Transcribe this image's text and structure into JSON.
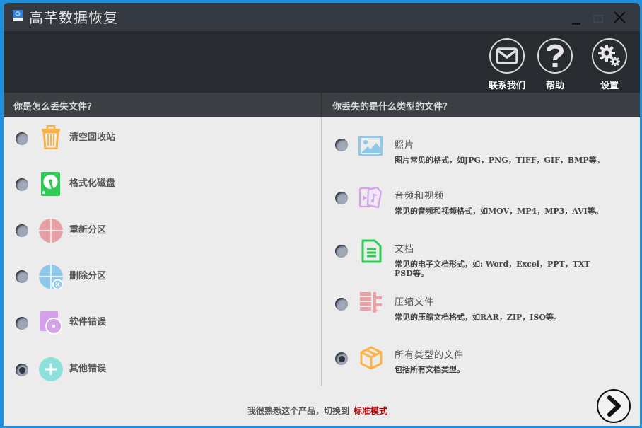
{
  "window": {
    "title": "高芊数据恢复"
  },
  "toolbar": {
    "contact_label": "联系我们",
    "help_label": "帮助",
    "settings_label": "设置"
  },
  "loss_section": {
    "heading": "你是怎么丢失文件？",
    "options": [
      {
        "label": "清空回收站",
        "icon": "trash-icon",
        "color": "#fbb444",
        "selected": false
      },
      {
        "label": "格式化磁盘",
        "icon": "hard-disk-icon",
        "color": "#2ecc55",
        "selected": false
      },
      {
        "label": "重新分区",
        "icon": "partition-icon",
        "color": "#e8a0a4",
        "selected": false
      },
      {
        "label": "删除分区",
        "icon": "delete-partition-icon",
        "color": "#8ec9ec",
        "selected": false
      },
      {
        "label": "软件错误",
        "icon": "software-error-icon",
        "color": "#d4a2e6",
        "selected": false
      },
      {
        "label": "其他错误",
        "icon": "plus-icon",
        "color": "#8ee0dc",
        "selected": true
      }
    ]
  },
  "type_section": {
    "heading": "你丢失的是什么类型的文件？",
    "options": [
      {
        "title": "照片",
        "desc": "图片常见的格式，如JPG，PNG，TIFF，GIF，BMP等。",
        "icon": "photo-icon",
        "color": "#8ec9ec",
        "selected": false
      },
      {
        "title": "音频和视频",
        "desc": "常见的音频和视频格式，如MOV，MP4，MP3，AVI等。",
        "icon": "media-icon",
        "color": "#d4a2e6",
        "selected": false
      },
      {
        "title": "文档",
        "desc": "常见的电子文档形式，如: Word，Excel，PPT，TXT PSD等。",
        "icon": "document-icon",
        "color": "#2ecc55",
        "selected": false
      },
      {
        "title": "压缩文件",
        "desc": "常见的压缩文档格式，如RAR，ZIP，ISO等。",
        "icon": "archive-icon",
        "color": "#e8a0a4",
        "selected": false
      },
      {
        "title": "所有类型的文件",
        "desc": "包括所有文档类型。",
        "icon": "box-icon",
        "color": "#fbb444",
        "selected": true
      }
    ]
  },
  "footer": {
    "text": "我很熟悉这个产品，切换到",
    "link": "标准模式"
  }
}
